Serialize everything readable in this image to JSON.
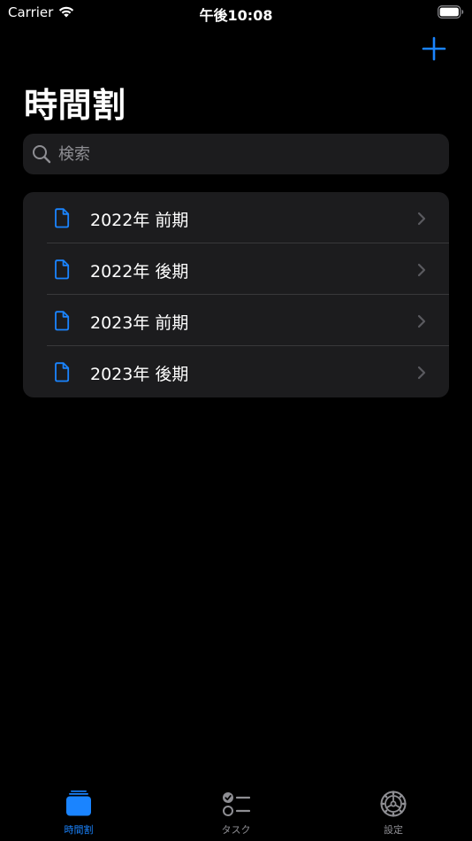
{
  "status_bar": {
    "carrier": "Carrier",
    "time": "午後10:08"
  },
  "nav": {
    "title": "時間割",
    "add_icon": "plus-icon"
  },
  "search": {
    "placeholder": "検索",
    "value": ""
  },
  "timetables": [
    {
      "label": "2022年 前期"
    },
    {
      "label": "2022年 後期"
    },
    {
      "label": "2023年 前期"
    },
    {
      "label": "2023年 後期"
    }
  ],
  "tabs": [
    {
      "label": "時間割",
      "icon": "stack-icon",
      "selected": true
    },
    {
      "label": "タスク",
      "icon": "checklist-icon",
      "selected": false
    },
    {
      "label": "設定",
      "icon": "gear-icon",
      "selected": false
    }
  ],
  "colors": {
    "accent": "#1a84ff",
    "background": "#000000",
    "cell": "#1c1c1e",
    "inactive": "#8e8e93"
  }
}
